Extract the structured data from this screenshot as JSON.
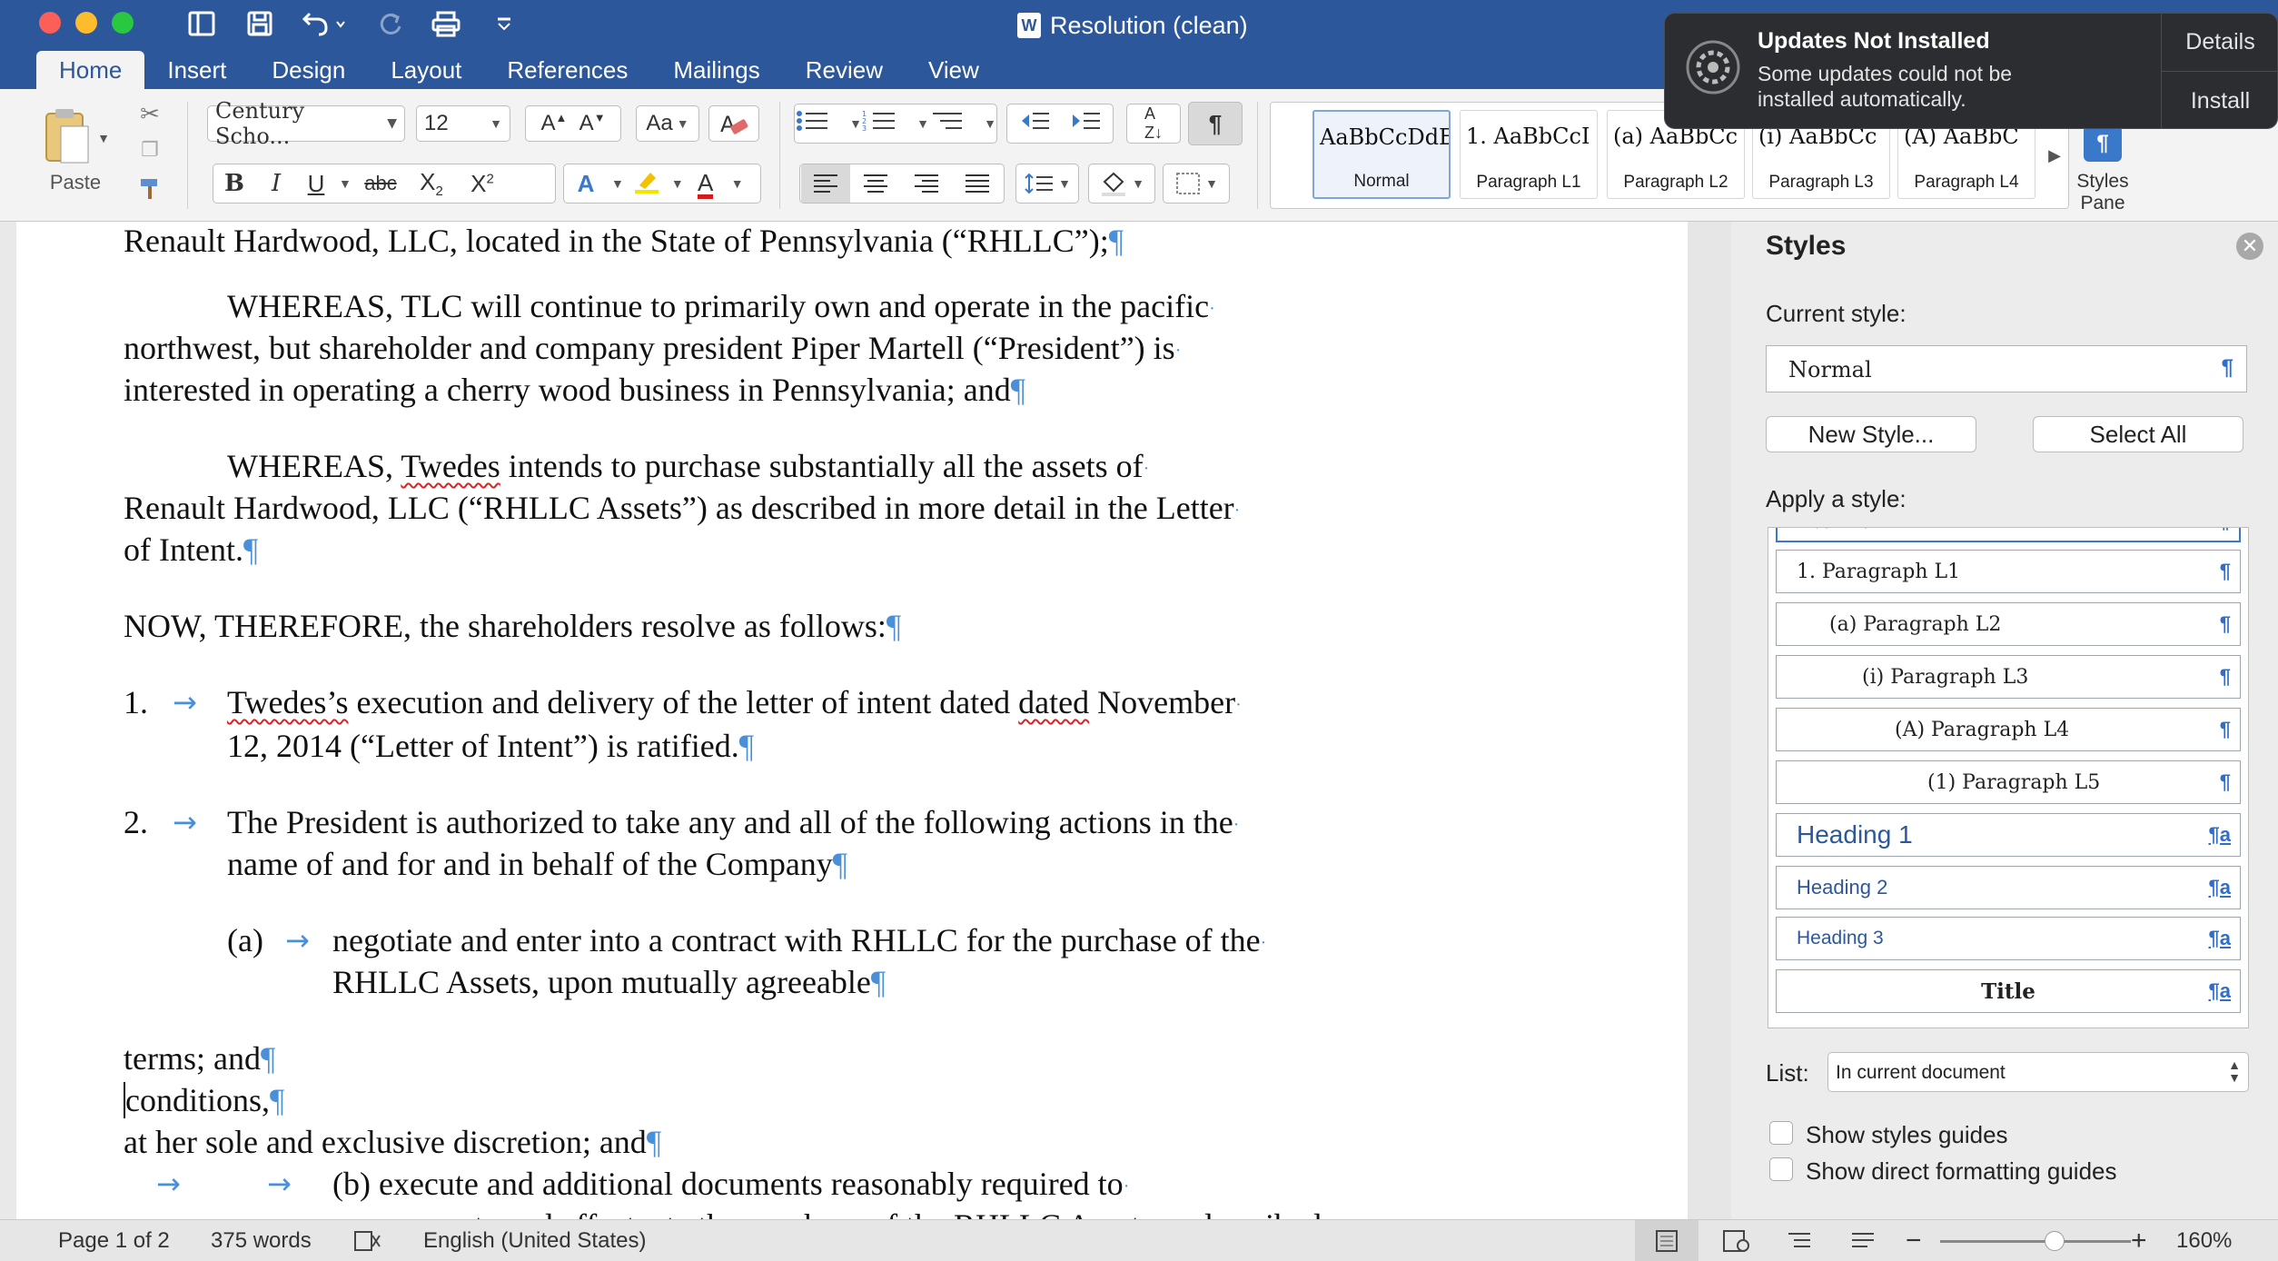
{
  "window": {
    "title": "Resolution (clean)"
  },
  "tabs": [
    "Home",
    "Insert",
    "Design",
    "Layout",
    "References",
    "Mailings",
    "Review",
    "View"
  ],
  "ribbon": {
    "paste_label": "Paste",
    "font_name": "Century Scho...",
    "font_size": "12",
    "style_gallery": [
      {
        "sample": "AaBbCcDdE",
        "label": "Normal"
      },
      {
        "sample": "1.  AaBbCcI",
        "label": "Paragraph L1"
      },
      {
        "sample": "(a)  AaBbCc",
        "label": "Paragraph L2"
      },
      {
        "sample": "(i)  AaBbCc",
        "label": "Paragraph L3"
      },
      {
        "sample": "(A)  AaBbC",
        "label": "Paragraph L4"
      }
    ],
    "styles_pane_label_1": "Styles",
    "styles_pane_label_2": "Pane"
  },
  "notification": {
    "title": "Updates Not Installed",
    "message": "Some updates could not be installed automatically.",
    "details_label": "Details",
    "install_label": "Install"
  },
  "document": {
    "l1": "Renault Hardwood, LLC, located in the State of Pennsylvania (“RHLLC”);",
    "p2_1": "WHEREAS, TLC will continue to primarily own and operate in the pacific",
    "p2_2": "northwest, but shareholder and company president Piper Martell (“President”) is",
    "p2_3": "interested in operating a cherry wood business in Pennsylvania; and",
    "p3_1a": "WHEREAS, ",
    "p3_1b": "Twedes",
    "p3_1c": " intends to purchase substantially all the assets of",
    "p3_2": "Renault Hardwood, LLC (“RHLLC Assets”) as described in more detail in the Letter",
    "p3_3": "of Intent.",
    "now": "NOW, THEREFORE, the shareholders resolve as follows:",
    "i1_num": "1.",
    "i1_1a": "Twedes’s",
    "i1_1b": " execution and delivery of the letter of intent dated ",
    "i1_1c": "dated",
    "i1_1d": " November",
    "i1_2": "12, 2014 (“Letter of Intent”) is ratified.",
    "i2_num": "2.",
    "i2_1": "The President is authorized to take any and all of the following actions in the",
    "i2_2": "name of and for and in behalf of the Company",
    "ia_num": "(a)",
    "ia_1": "negotiate and enter into a contract with RHLLC for the purchase of the",
    "ia_2": "RHLLC Assets, upon mutually agreeable",
    "t1": "terms; and",
    "t2": "conditions,",
    "t3": "at her sole and exclusive discretion; and",
    "b_text": "(b) execute and additional documents reasonably required to",
    "b_cut": "consummate and effectuate the purchase of the RHLLC Assets as described"
  },
  "styles_pane": {
    "title": "Styles",
    "current_style_label": "Current style:",
    "current_style_value": "Normal",
    "new_style_button": "New Style...",
    "select_all_button": "Select All",
    "apply_label": "Apply a style:",
    "styles": [
      {
        "name": "Normal"
      },
      {
        "name": "1.  Paragraph L1"
      },
      {
        "name": "(a)  Paragraph L2"
      },
      {
        "name": "(i)  Paragraph L3"
      },
      {
        "name": "(A)  Paragraph L4"
      },
      {
        "name": "(1)  Paragraph L5"
      },
      {
        "name": "Heading 1"
      },
      {
        "name": "Heading 2"
      },
      {
        "name": "Heading 3"
      },
      {
        "name": "Title"
      }
    ],
    "list_label": "List:",
    "list_value": "In current document",
    "show_styles_guides": "Show styles guides",
    "show_direct_formatting": "Show direct formatting guides"
  },
  "status_bar": {
    "page": "Page 1 of 2",
    "words": "375 words",
    "language": "English (United States)",
    "zoom": "160%",
    "zoom_level": 0.6
  },
  "colors": {
    "accent": "#2c579a",
    "paragraph_mark": "#4a90d9",
    "notification_bg": "#2b2d31"
  }
}
